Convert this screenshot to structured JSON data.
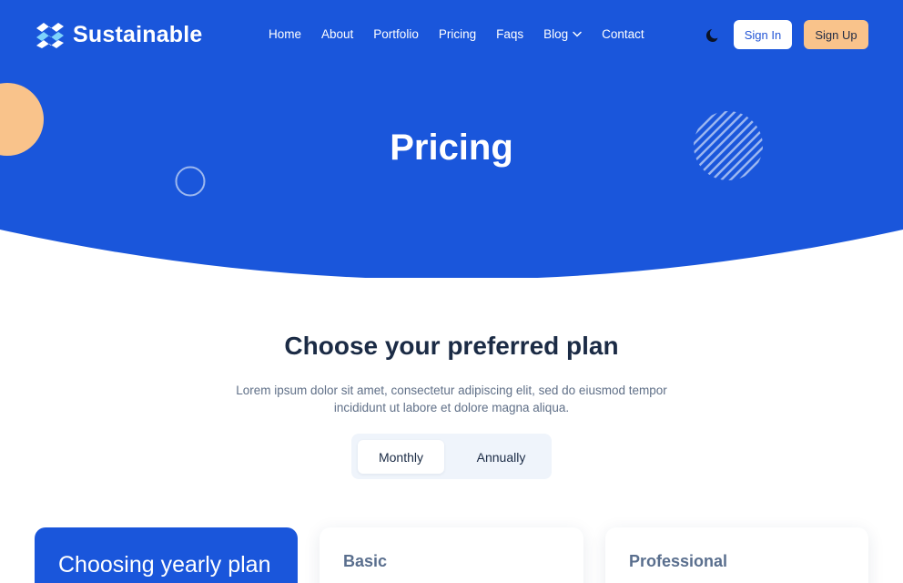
{
  "brand": {
    "name": "Sustainable",
    "logo_icon": "waves-logo-icon"
  },
  "nav": {
    "items": [
      {
        "label": "Home"
      },
      {
        "label": "About"
      },
      {
        "label": "Portfolio"
      },
      {
        "label": "Pricing"
      },
      {
        "label": "Faqs"
      },
      {
        "label": "Blog",
        "has_dropdown": true
      },
      {
        "label": "Contact"
      }
    ]
  },
  "header": {
    "theme_icon": "moon-icon",
    "sign_in_label": "Sign In",
    "sign_up_label": "Sign Up"
  },
  "hero": {
    "title": "Pricing"
  },
  "pricing": {
    "title": "Choose your preferred plan",
    "description": "Lorem ipsum dolor sit amet, consectetur adipiscing elit, sed do eiusmod tempor incididunt ut labore et dolore magna aliqua.",
    "billing_toggle": {
      "options": [
        {
          "label": "Monthly"
        },
        {
          "label": "Annually"
        }
      ],
      "selected": "Monthly"
    },
    "cards": [
      {
        "title": "Choosing yearly plan"
      },
      {
        "name": "Basic"
      },
      {
        "name": "Professional"
      }
    ]
  },
  "colors": {
    "primary": "#1a56db",
    "accent": "#f9c38b",
    "heading": "#1b2b45",
    "body_text": "#607088"
  }
}
